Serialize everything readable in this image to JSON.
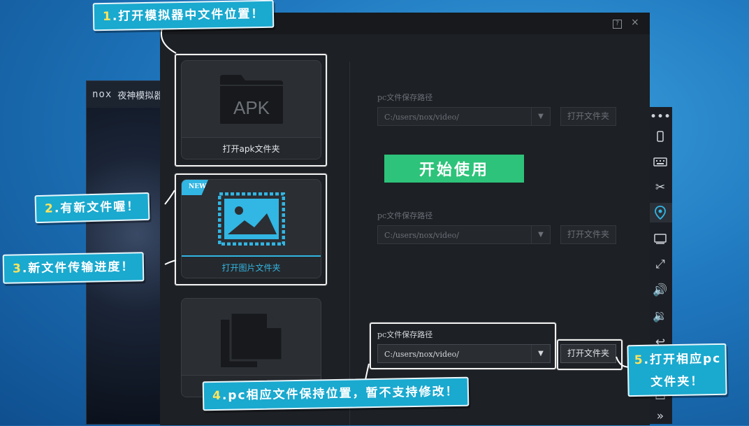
{
  "background_window": {
    "logo": "nox",
    "title": "夜神模拟器"
  },
  "dialog": {
    "help_icon": "?",
    "close_icon": "×"
  },
  "cards": [
    {
      "icon": "apk-folder-icon",
      "icon_text": "APK",
      "label": "打开apk文件夹",
      "active": false
    },
    {
      "icon": "image-icon",
      "badge": "NEW",
      "label": "打开图片文件夹",
      "active": true
    },
    {
      "icon": "documents-icon",
      "label": "",
      "active": false
    }
  ],
  "sections": [
    {
      "label": "pc文件保存路径",
      "path": "C:/users/nox/video/",
      "button": "打开文件夹",
      "active": false
    },
    {
      "label": "pc文件保存路径",
      "path": "C:/users/nox/video/",
      "button": "打开文件夹",
      "active": false
    },
    {
      "label": "pc文件保存路径",
      "path": "C:/users/nox/video/",
      "button": "打开文件夹",
      "active": true
    }
  ],
  "start_button": "开始使用",
  "toolbar": [
    "more-icon",
    "rotate-icon",
    "keyboard-icon",
    "scissors-icon",
    "location-icon",
    "screen-icon",
    "fullscreen-icon",
    "volume-up-icon",
    "volume-down-icon",
    "back-icon",
    "home-icon",
    "expand-icon"
  ],
  "callouts": [
    {
      "num": "1",
      "text": ".打开模拟器中文件位置！"
    },
    {
      "num": "2",
      "text": ".有新文件喔！"
    },
    {
      "num": "3",
      "text": ".新文件传输进度！"
    },
    {
      "num": "4",
      "text": ".pc相应文件保持位置，暂不支持修改！"
    },
    {
      "num": "5",
      "text": ".打开相应pc",
      "text2": "文件夹！"
    }
  ],
  "colors": {
    "accent": "#32b6e3",
    "start": "#2dc37a",
    "callout": "#1aa9cf",
    "dialog": "#1d2024"
  }
}
